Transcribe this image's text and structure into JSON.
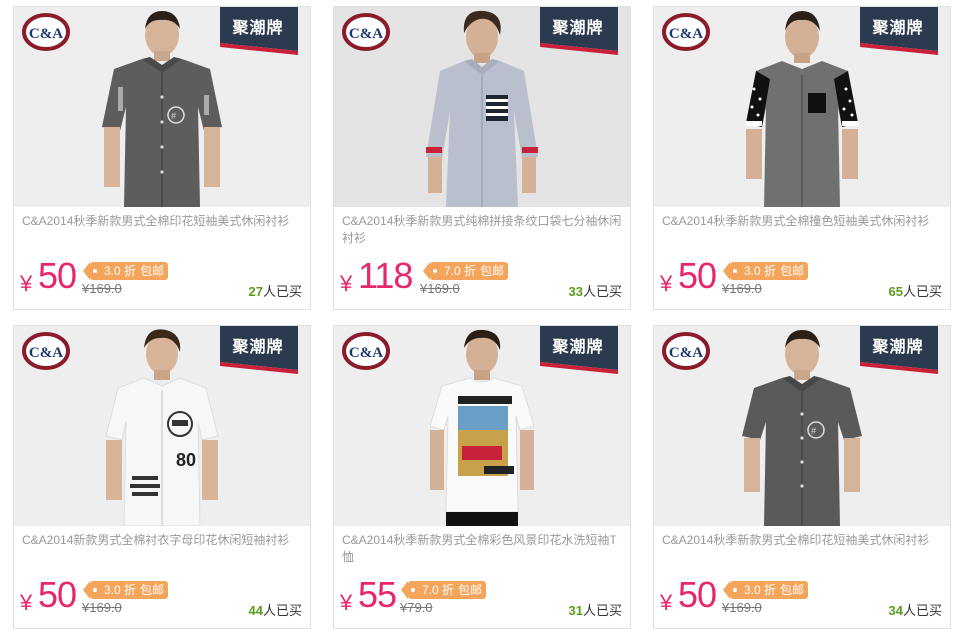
{
  "products": [
    {
      "ribbon": "聚潮牌",
      "logo": "C&A",
      "title": "C&A2014秋季新款男式全棉印花短袖美式休闲衬衫",
      "currency": "¥",
      "price": "50",
      "discount": "3.0 折",
      "shipping_badge": "包邮",
      "original_price": "¥169.0",
      "sold_count": "27",
      "sold_suffix": "人已买",
      "shirt_style": "dark-print"
    },
    {
      "ribbon": "聚潮牌",
      "logo": "C&A",
      "title": "C&A2014秋季新款男式纯棉拼接条纹口袋七分袖休闲衬衫",
      "currency": "¥",
      "price": "118",
      "discount": "7.0 折",
      "shipping_badge": "包邮",
      "original_price": "¥169.0",
      "sold_count": "33",
      "sold_suffix": "人已买",
      "shirt_style": "light-stripe-pocket"
    },
    {
      "ribbon": "聚潮牌",
      "logo": "C&A",
      "title": "C&A2014秋季新款男式全棉撞色短袖美式休闲衬衫",
      "currency": "¥",
      "price": "50",
      "discount": "3.0 折",
      "shipping_badge": "包邮",
      "original_price": "¥169.0",
      "sold_count": "65",
      "sold_suffix": "人已买",
      "shirt_style": "grey-polka-sleeves"
    },
    {
      "ribbon": "聚潮牌",
      "logo": "C&A",
      "title": "C&A2014新款男式全棉衬衣字母印花休闲短袖衬衫",
      "currency": "¥",
      "price": "50",
      "discount": "3.0 折",
      "shipping_badge": "包邮",
      "original_price": "¥169.0",
      "sold_count": "44",
      "sold_suffix": "人已买",
      "shirt_style": "white-letter-print"
    },
    {
      "ribbon": "聚潮牌",
      "logo": "C&A",
      "title": "C&A2014秋季新款男式全棉彩色风景印花水洗短袖T恤",
      "currency": "¥",
      "price": "55",
      "discount": "7.0 折",
      "shipping_badge": "包邮",
      "original_price": "¥79.0",
      "sold_count": "31",
      "sold_suffix": "人已买",
      "shirt_style": "white-tee-print"
    },
    {
      "ribbon": "聚潮牌",
      "logo": "C&A",
      "title": "C&A2014秋季新款男式全棉印花短袖美式休闲衬衫",
      "currency": "¥",
      "price": "50",
      "discount": "3.0 折",
      "shipping_badge": "包邮",
      "original_price": "¥169.0",
      "sold_count": "34",
      "sold_suffix": "人已买",
      "shirt_style": "dark-print"
    }
  ],
  "colors": {
    "price": "#e8266b",
    "tag": "#f5a55b",
    "ribbon": "#2b3a4f",
    "ribbon_accent": "#c8213a",
    "sold_count": "#5a9e1c",
    "logo_ring": "#8b1a2b"
  }
}
